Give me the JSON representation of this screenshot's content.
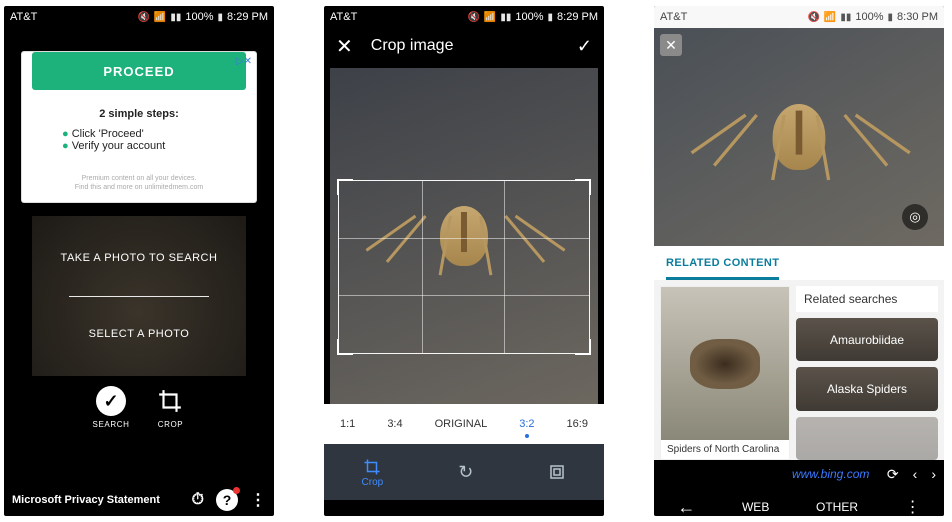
{
  "statusbar": {
    "carrier": "AT&T",
    "battery": "100%",
    "time_a": "8:29 PM",
    "time_b": "8:29 PM",
    "time_c": "8:30 PM"
  },
  "screen1": {
    "ad": {
      "close_glyph": "▷✕",
      "proceed_label": "PROCEED",
      "steps_title": "2 simple steps:",
      "bullets": [
        "Click 'Proceed'",
        "Verify your account"
      ],
      "fine1": "Premium content on all your devices.",
      "fine2": "Find this and more on unlimitedmem.com"
    },
    "photo": {
      "take": "TAKE A PHOTO TO SEARCH",
      "select": "SELECT A PHOTO"
    },
    "tools": {
      "search": "SEARCH",
      "crop": "CROP"
    },
    "footer": {
      "privacy": "Microsoft Privacy Statement"
    }
  },
  "screen2": {
    "title": "Crop image",
    "ratios": [
      "1:1",
      "3:4",
      "ORIGINAL",
      "3:2",
      "16:9"
    ],
    "ratio_selected_index": 3,
    "toolbar": {
      "crop": "Crop"
    }
  },
  "screen3": {
    "tab": "RELATED CONTENT",
    "result_caption": "Spiders of North Carolina",
    "related_title": "Related searches",
    "related_items": [
      "Amaurobiidae",
      "Alaska Spiders"
    ],
    "url": "www.bing.com",
    "nav": {
      "web": "WEB",
      "other": "OTHER"
    }
  }
}
